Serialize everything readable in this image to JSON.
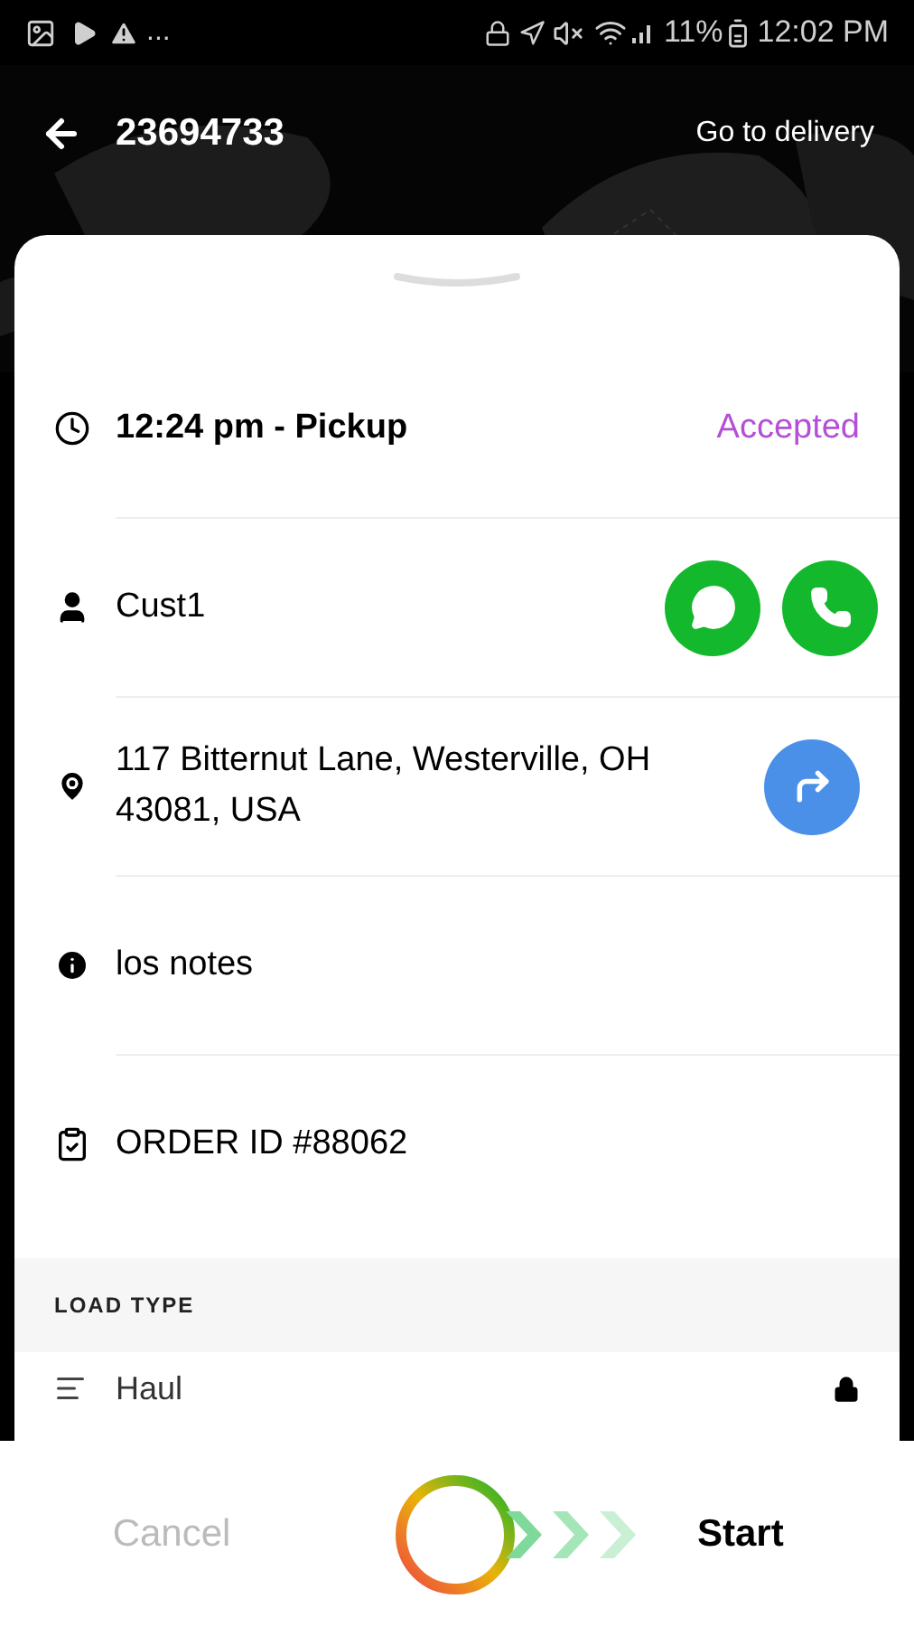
{
  "status_bar": {
    "overflow": "...",
    "battery": "11%",
    "time": "12:02 PM"
  },
  "header": {
    "title": "23694733",
    "action": "Go to delivery"
  },
  "details": [
    {
      "kind": "time",
      "text": "12:24 pm - Pickup",
      "status": "Accepted"
    },
    {
      "kind": "contact",
      "text": "Cust1"
    },
    {
      "kind": "address",
      "text": "117 Bitternut Lane, Westerville, OH 43081, USA"
    },
    {
      "kind": "notes",
      "text": "los notes"
    },
    {
      "kind": "order",
      "text": "ORDER ID #88062"
    }
  ],
  "load_type": {
    "heading": "LOAD TYPE",
    "value": "Haul",
    "locked": true
  },
  "footer": {
    "cancel": "Cancel",
    "start": "Start"
  }
}
